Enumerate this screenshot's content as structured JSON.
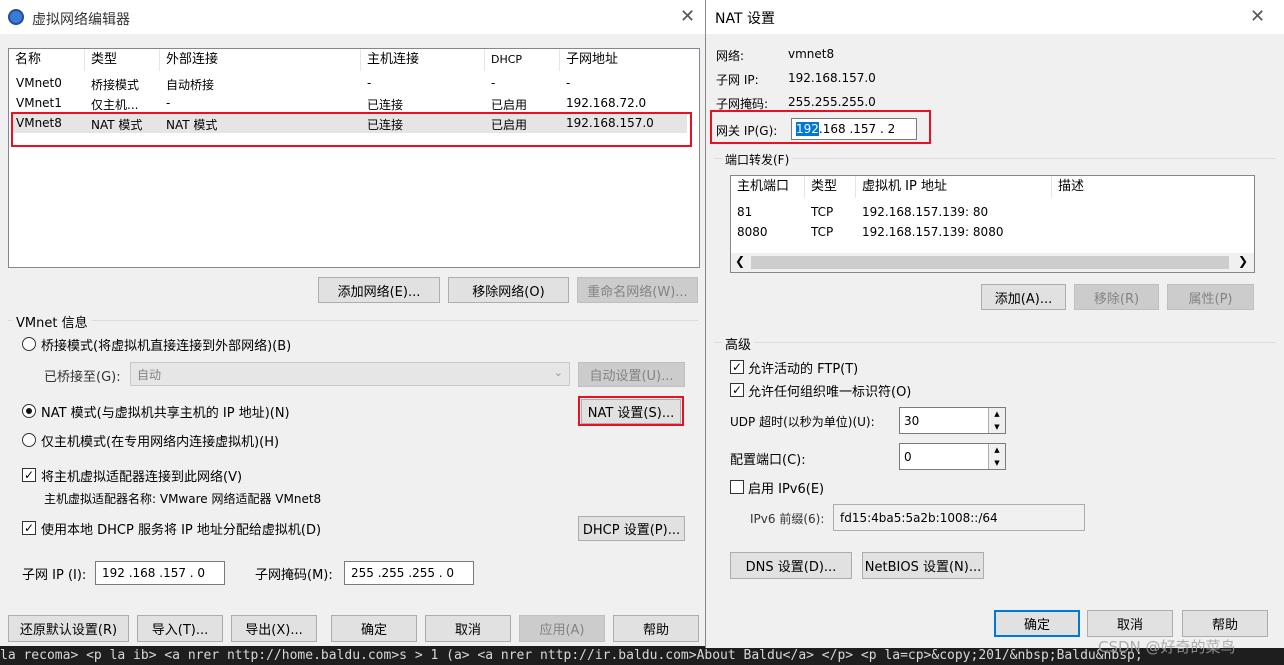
{
  "left": {
    "title": "虚拟网络编辑器",
    "columns": [
      "名称",
      "类型",
      "外部连接",
      "主机连接",
      "DHCP",
      "子网地址"
    ],
    "rows": [
      [
        "VMnet0",
        "桥接模式",
        "自动桥接",
        "-",
        "-",
        "-"
      ],
      [
        "VMnet1",
        "仅主机...",
        "-",
        "已连接",
        "已启用",
        "192.168.72.0"
      ],
      [
        "VMnet8",
        "NAT 模式",
        "NAT 模式",
        "已连接",
        "已启用",
        "192.168.157.0"
      ]
    ],
    "add_network": "添加网络(E)...",
    "remove_network": "移除网络(O)",
    "rename_network": "重命名网络(W)...",
    "vmnet_info": "VMnet 信息",
    "bridge_mode": "桥接模式(将虚拟机直接连接到外部网络)(B)",
    "bridged_to_label": "已桥接至(G):",
    "bridged_to_value": "自动",
    "auto_settings": "自动设置(U)...",
    "nat_mode": "NAT 模式(与虚拟机共享主机的 IP 地址)(N)",
    "nat_settings": "NAT 设置(S)...",
    "host_only": "仅主机模式(在专用网络内连接虚拟机)(H)",
    "connect_adapter": "将主机虚拟适配器连接到此网络(V)",
    "adapter_name": "主机虚拟适配器名称: VMware 网络适配器 VMnet8",
    "use_dhcp": "使用本地 DHCP 服务将 IP 地址分配给虚拟机(D)",
    "dhcp_settings": "DHCP 设置(P)...",
    "subnet_ip_label": "子网 IP (I):",
    "subnet_ip": "192 .168 .157 .  0",
    "subnet_mask_label": "子网掩码(M):",
    "subnet_mask": "255 .255 .255 .  0",
    "restore": "还原默认设置(R)",
    "import": "导入(T)...",
    "export": "导出(X)...",
    "ok": "确定",
    "cancel": "取消",
    "apply": "应用(A)",
    "help": "帮助"
  },
  "right": {
    "title": "NAT 设置",
    "network_label": "网络:",
    "network_value": "vmnet8",
    "subnet_ip_label": "子网 IP:",
    "subnet_ip_value": "192.168.157.0",
    "subnet_mask_label": "子网掩码:",
    "subnet_mask_value": "255.255.255.0",
    "gateway_label": "网关 IP(G):",
    "gateway_first": "192",
    "gateway_rest": " .168 .157 .  2",
    "port_forward": "端口转发(F)",
    "pf_columns": [
      "主机端口",
      "类型",
      "虚拟机 IP 地址",
      "描述"
    ],
    "pf_rows": [
      [
        "81",
        "TCP",
        "192.168.157.139: 80",
        ""
      ],
      [
        "8080",
        "TCP",
        "192.168.157.139: 8080",
        ""
      ]
    ],
    "add": "添加(A)...",
    "remove": "移除(R)",
    "properties": "属性(P)",
    "advanced": "高级",
    "allow_ftp": "允许活动的 FTP(T)",
    "allow_oui": "允许任何组织唯一标识符(O)",
    "udp_label": "UDP 超时(以秒为单位)(U):",
    "udp_value": "30",
    "config_port_label": "配置端口(C):",
    "config_port_value": "0",
    "enable_ipv6": "启用 IPv6(E)",
    "ipv6_prefix_label": "IPv6 前缀(6):",
    "ipv6_prefix_value": "fd15:4ba5:5a2b:1008::/64",
    "dns": "DNS 设置(D)...",
    "netbios": "NetBIOS 设置(N)...",
    "ok": "确定",
    "cancel": "取消",
    "help": "帮助"
  },
  "background_text": "la recoma> <p la ib> <a nrer nttp://home.baldu.com>s > 1 (a> <a nrer nttp://ir.baldu.com>About Baldu</a> </p> <p la=cp>&copy;201/&nbsp;Baldu&nbsp;",
  "watermark": "CSDN @好奇的菜鸟"
}
